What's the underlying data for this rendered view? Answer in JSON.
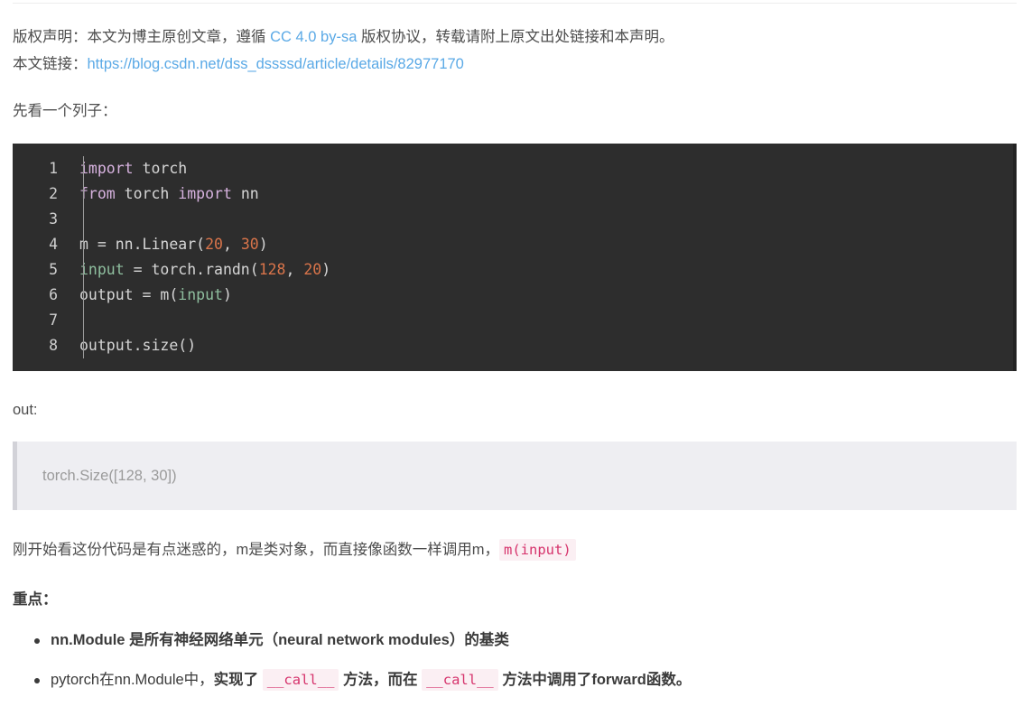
{
  "copyright": {
    "label": "版权声明：",
    "text_before_link": "本文为博主原创文章，遵循 ",
    "license_link": "CC 4.0 by-sa",
    "text_after_link": " 版权协议，转载请附上原文出处链接和本声明。",
    "source_label": "本文链接：",
    "source_url": "https://blog.csdn.net/dss_dssssd/article/details/82977170"
  },
  "intro": {
    "text": "先看一个列子："
  },
  "code_block": {
    "language": "python",
    "lines": [
      {
        "num": "1",
        "tokens": [
          {
            "t": "import",
            "c": "kw"
          },
          {
            "t": " torch",
            "c": "plain"
          }
        ]
      },
      {
        "num": "2",
        "tokens": [
          {
            "t": "from",
            "c": "kw"
          },
          {
            "t": " torch ",
            "c": "plain"
          },
          {
            "t": "import",
            "c": "kw"
          },
          {
            "t": " nn",
            "c": "plain"
          }
        ]
      },
      {
        "num": "3",
        "tokens": []
      },
      {
        "num": "4",
        "tokens": [
          {
            "t": "m = nn.Linear(",
            "c": "plain"
          },
          {
            "t": "20",
            "c": "num"
          },
          {
            "t": ", ",
            "c": "plain"
          },
          {
            "t": "30",
            "c": "num"
          },
          {
            "t": ")",
            "c": "plain"
          }
        ]
      },
      {
        "num": "5",
        "tokens": [
          {
            "t": "input",
            "c": "builtin"
          },
          {
            "t": " = torch.randn(",
            "c": "plain"
          },
          {
            "t": "128",
            "c": "num"
          },
          {
            "t": ", ",
            "c": "plain"
          },
          {
            "t": "20",
            "c": "num"
          },
          {
            "t": ")",
            "c": "plain"
          }
        ]
      },
      {
        "num": "6",
        "tokens": [
          {
            "t": "output = m(",
            "c": "plain"
          },
          {
            "t": "input",
            "c": "builtin"
          },
          {
            "t": ")",
            "c": "plain"
          }
        ]
      },
      {
        "num": "7",
        "tokens": []
      },
      {
        "num": "8",
        "tokens": [
          {
            "t": "output.size()",
            "c": "plain"
          }
        ]
      }
    ]
  },
  "out_section": {
    "label": "out:",
    "quote_text": "torch.Size([128, 30])"
  },
  "narrative": {
    "paragraph_before_code": "刚开始看这份代码是有点迷惑的，m是类对象，而直接像函数一样调用m，",
    "inline_code": "m(input)",
    "key_points_heading": "重点："
  },
  "bullets": [
    {
      "segments": [
        {
          "text": "nn.Module 是所有神经网络单元（neural network modules）的基类",
          "style": "bold"
        }
      ]
    },
    {
      "segments": [
        {
          "text": "pytorch在nn.Module中，",
          "style": "normal"
        },
        {
          "text": "实现了 ",
          "style": "bold"
        },
        {
          "text": "__call__",
          "style": "code"
        },
        {
          "text": " 方法，而在 ",
          "style": "bold"
        },
        {
          "text": "__call__",
          "style": "code"
        },
        {
          "text": " 方法中调用了forward函数。",
          "style": "bold"
        }
      ]
    }
  ],
  "colors": {
    "page_background": "#ffffff",
    "body_text": "#4d4d4d",
    "link": "#5aa9e6",
    "code_background": "#2d2d2d",
    "code_text": "#d6d6d6",
    "code_keyword": "#d8b3e0",
    "code_number": "#d9744a",
    "code_builtin": "#8fbf9f",
    "line_number": "#cfcfcf",
    "blockquote_background": "#eeeef2",
    "blockquote_border": "#d2d2d8",
    "blockquote_text": "#9a9a9a",
    "inline_code_background": "#fbeff3",
    "inline_code_text": "#d6336c"
  }
}
